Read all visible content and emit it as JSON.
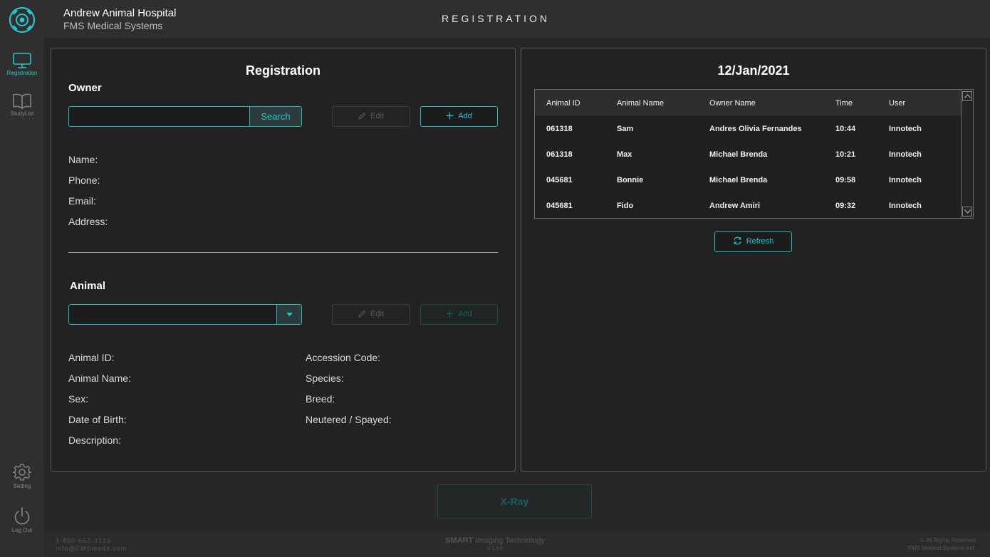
{
  "sidebar": {
    "items": [
      {
        "label": "Registration",
        "icon": "monitor-icon",
        "active": true
      },
      {
        "label": "StudyList",
        "icon": "book-icon",
        "active": false
      },
      {
        "label": "Setting",
        "icon": "gear-icon",
        "active": false
      },
      {
        "label": "Log Out",
        "icon": "power-icon",
        "active": false
      }
    ]
  },
  "header": {
    "hospital_name": "Andrew Animal Hospital",
    "company": "FMS Medical Systems",
    "title": "REGISTRATION"
  },
  "registration": {
    "title": "Registration",
    "owner": {
      "section_title": "Owner",
      "search_value": "",
      "search_label": "Search",
      "edit_label": "Edit",
      "add_label": "Add",
      "fields": [
        "Name:",
        "Phone:",
        "Email:",
        "Address:"
      ]
    },
    "animal": {
      "section_title": "Animal",
      "select_value": "",
      "edit_label": "Edit",
      "add_label": "Add",
      "fields_left": [
        "Animal ID:",
        "Animal Name:",
        "Sex:",
        "Date of Birth:",
        "Description:"
      ],
      "fields_right": [
        "Accession Code:",
        "Species:",
        "Breed:",
        "Neutered / Spayed:"
      ]
    }
  },
  "studies": {
    "date": "12/Jan/2021",
    "columns": [
      "Animal ID",
      "Animal Name",
      "Owner Name",
      "Time",
      "User"
    ],
    "rows": [
      [
        "061318",
        "Sam",
        "Andres Olivia Fernandes",
        "10:44",
        "Innotech"
      ],
      [
        "061318",
        "Max",
        "Michael Brenda",
        "10:21",
        "Innotech"
      ],
      [
        "045681",
        "Bonnie",
        "Michael Brenda",
        "09:58",
        "Innotech"
      ],
      [
        "045681",
        "Fido",
        "Andrew Amiri",
        "09:32",
        "Innotech"
      ]
    ],
    "refresh_label": "Refresh"
  },
  "actions": {
    "xray_label": "X-Ray"
  },
  "footer": {
    "phone": "1-800-652-3123",
    "email": "info@FMSmeds.com",
    "brand_bold": "SMART",
    "brand_rest": "Imaging Technology",
    "version": "V 1.0.0",
    "rights": "All Rights Reserved",
    "rights_company": "FMS Medical Systems Ind."
  },
  "colors": {
    "accent": "#27c6cc",
    "background": "#272727",
    "panel": "#222222"
  }
}
